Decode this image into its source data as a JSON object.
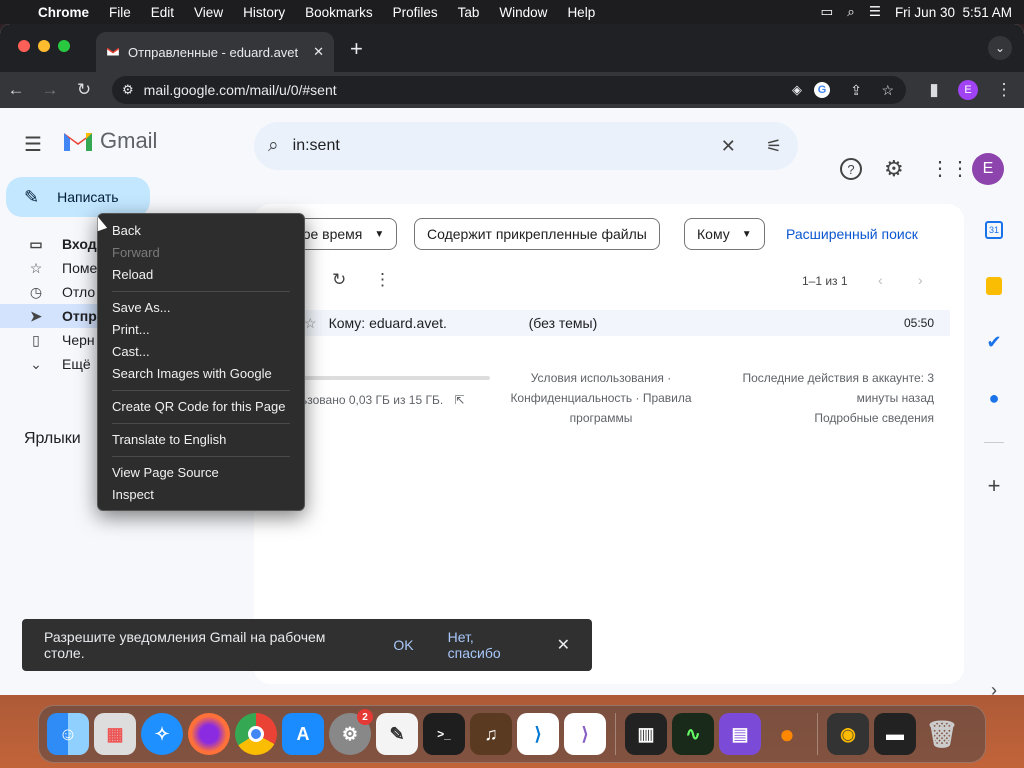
{
  "menubar": {
    "apple_icon": "apple-icon",
    "app_name": "Chrome",
    "menus": [
      "File",
      "Edit",
      "View",
      "History",
      "Bookmarks",
      "Profiles",
      "Tab",
      "Window",
      "Help"
    ],
    "datetime": "Fri Jun 30  5:51 AM"
  },
  "chrome": {
    "tab_title": "Отправленные - eduard.avet",
    "new_tab_symbol": "+",
    "url": "mail.google.com/mail/u/0/#sent",
    "profile_initial": "E"
  },
  "gmail": {
    "logo_text": "Gmail",
    "search_value": "in:sent",
    "compose_label": "Написать",
    "nav": [
      "Входя",
      "Поме",
      "Отло",
      "Отпр",
      "Черн",
      "Ещё"
    ],
    "labels_heading": "Ярлыки",
    "avatar_initial": "E",
    "filters": [
      "Любое время",
      "Содержит прикрепленные файлы",
      "Кому"
    ],
    "advanced_search": "Расширенный поиск",
    "pagination": "1–1 из 1",
    "email_row": {
      "recipient": "Кому: eduard.avet.",
      "subject": "(без темы)",
      "time": "05:50"
    },
    "storage": "льзовано 0,03 ГБ из 15 ГБ.",
    "footer_center": [
      "Условия использования ·",
      "Конфиденциальность · Правила",
      "программы"
    ],
    "footer_right": [
      "Последние действия в аккаунте: 3",
      "минуты назад",
      "Подробные сведения"
    ]
  },
  "context_menu": {
    "groups": [
      [
        {
          "label": "Back",
          "disabled": false
        },
        {
          "label": "Forward",
          "disabled": true
        },
        {
          "label": "Reload",
          "disabled": false
        }
      ],
      [
        {
          "label": "Save As...",
          "disabled": false
        },
        {
          "label": "Print...",
          "disabled": false
        },
        {
          "label": "Cast...",
          "disabled": false
        },
        {
          "label": "Search Images with Google",
          "disabled": false
        }
      ],
      [
        {
          "label": "Create QR Code for this Page",
          "disabled": false
        }
      ],
      [
        {
          "label": "Translate to English",
          "disabled": false
        }
      ],
      [
        {
          "label": "View Page Source",
          "disabled": false
        },
        {
          "label": "Inspect",
          "disabled": false
        }
      ]
    ]
  },
  "toast": {
    "message": "Разрешите уведомления Gmail на рабочем столе.",
    "ok": "OK",
    "no_thanks": "Нет, спасибо"
  },
  "dock": {
    "settings_badge": "2",
    "apps": [
      "finder",
      "launchpad",
      "safari",
      "firefox",
      "chrome",
      "app-store",
      "system-settings",
      "textedit",
      "terminal",
      "instruments",
      "vscode",
      "visual-studio",
      "piano",
      "activity-monitor",
      "simulator",
      "xcode-instruments",
      "preview",
      "screenshot",
      "trash"
    ]
  }
}
